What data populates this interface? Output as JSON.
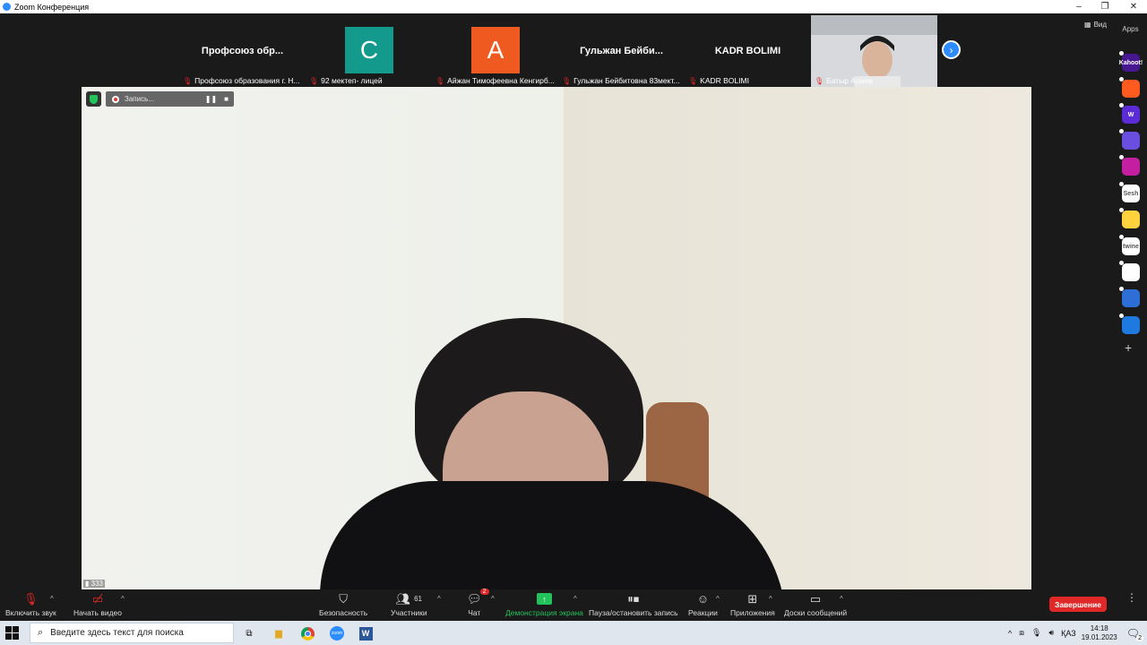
{
  "window": {
    "title": "Zoom Конференция",
    "controls": [
      "–",
      "❐",
      "✕"
    ]
  },
  "view_button": "Вид",
  "apps_panel": {
    "title": "Apps",
    "icons": [
      {
        "name": "kahoot",
        "text": "Kahoot!",
        "bg": "#46178f"
      },
      {
        "name": "app-orange",
        "text": "",
        "bg": "#ff5a1f"
      },
      {
        "name": "wooclap",
        "text": "W",
        "bg": "#5b2bd7"
      },
      {
        "name": "app-purple-circle",
        "text": "",
        "bg": "#6a4ee0"
      },
      {
        "name": "app-magenta",
        "text": "",
        "bg": "#c51fa1"
      },
      {
        "name": "sesh",
        "text": "Sesh",
        "bg": "#ffffff"
      },
      {
        "name": "app-emoji",
        "text": "",
        "bg": "#ffd23e"
      },
      {
        "name": "twine",
        "text": "twine",
        "bg": "#ffffff"
      },
      {
        "name": "app-multi",
        "text": "",
        "bg": "#ffffff"
      },
      {
        "name": "app-blue-circle",
        "text": "",
        "bg": "#2d6fd6"
      },
      {
        "name": "app-blue-lines",
        "text": "",
        "bg": "#1f7ae0"
      }
    ],
    "add": "+"
  },
  "participants_strip": [
    {
      "kind": "name",
      "big": "Профсоюз обр...",
      "label": "Профсоюз образования г. Н..."
    },
    {
      "kind": "avatar",
      "letter": "С",
      "color": "#149a8c",
      "label": "92 мектеп- лицей"
    },
    {
      "kind": "avatar",
      "letter": "А",
      "color": "#ef5a21",
      "label": "Айжан Тимофеевна Кенгирб..."
    },
    {
      "kind": "name",
      "big": "Гульжан Бейби...",
      "label": "Гульжан Бейбитовна 83мект..."
    },
    {
      "kind": "name",
      "big": "KADR BOLIMI",
      "label": "KADR BOLIMI"
    },
    {
      "kind": "video",
      "label": "Батыр Алиев"
    }
  ],
  "recording": {
    "status": "Запись...",
    "pause": "❚❚",
    "stop": "■"
  },
  "main_video": {
    "signal": "333"
  },
  "toolbar": {
    "unmute": "Включить звук",
    "start_video": "Начать видео",
    "security": "Безопасность",
    "participants": "Участники",
    "participants_count": "61",
    "chat": "Чат",
    "chat_badge": "2",
    "share_screen": "Демонстрация экрана",
    "pause_record": "Пауза/остановить запись",
    "reactions": "Реакции",
    "apps": "Приложения",
    "whiteboards": "Доски сообщений",
    "end": "Завершение"
  },
  "taskbar": {
    "search_placeholder": "Введите здесь текст для поиска",
    "lang": "ҚАЗ",
    "time": "14:18",
    "date": "19.01.2023",
    "notif_count": "2"
  },
  "colors": {
    "accent": "#2d8cff",
    "end_red": "#e02828",
    "share_green": "#23c35b"
  }
}
